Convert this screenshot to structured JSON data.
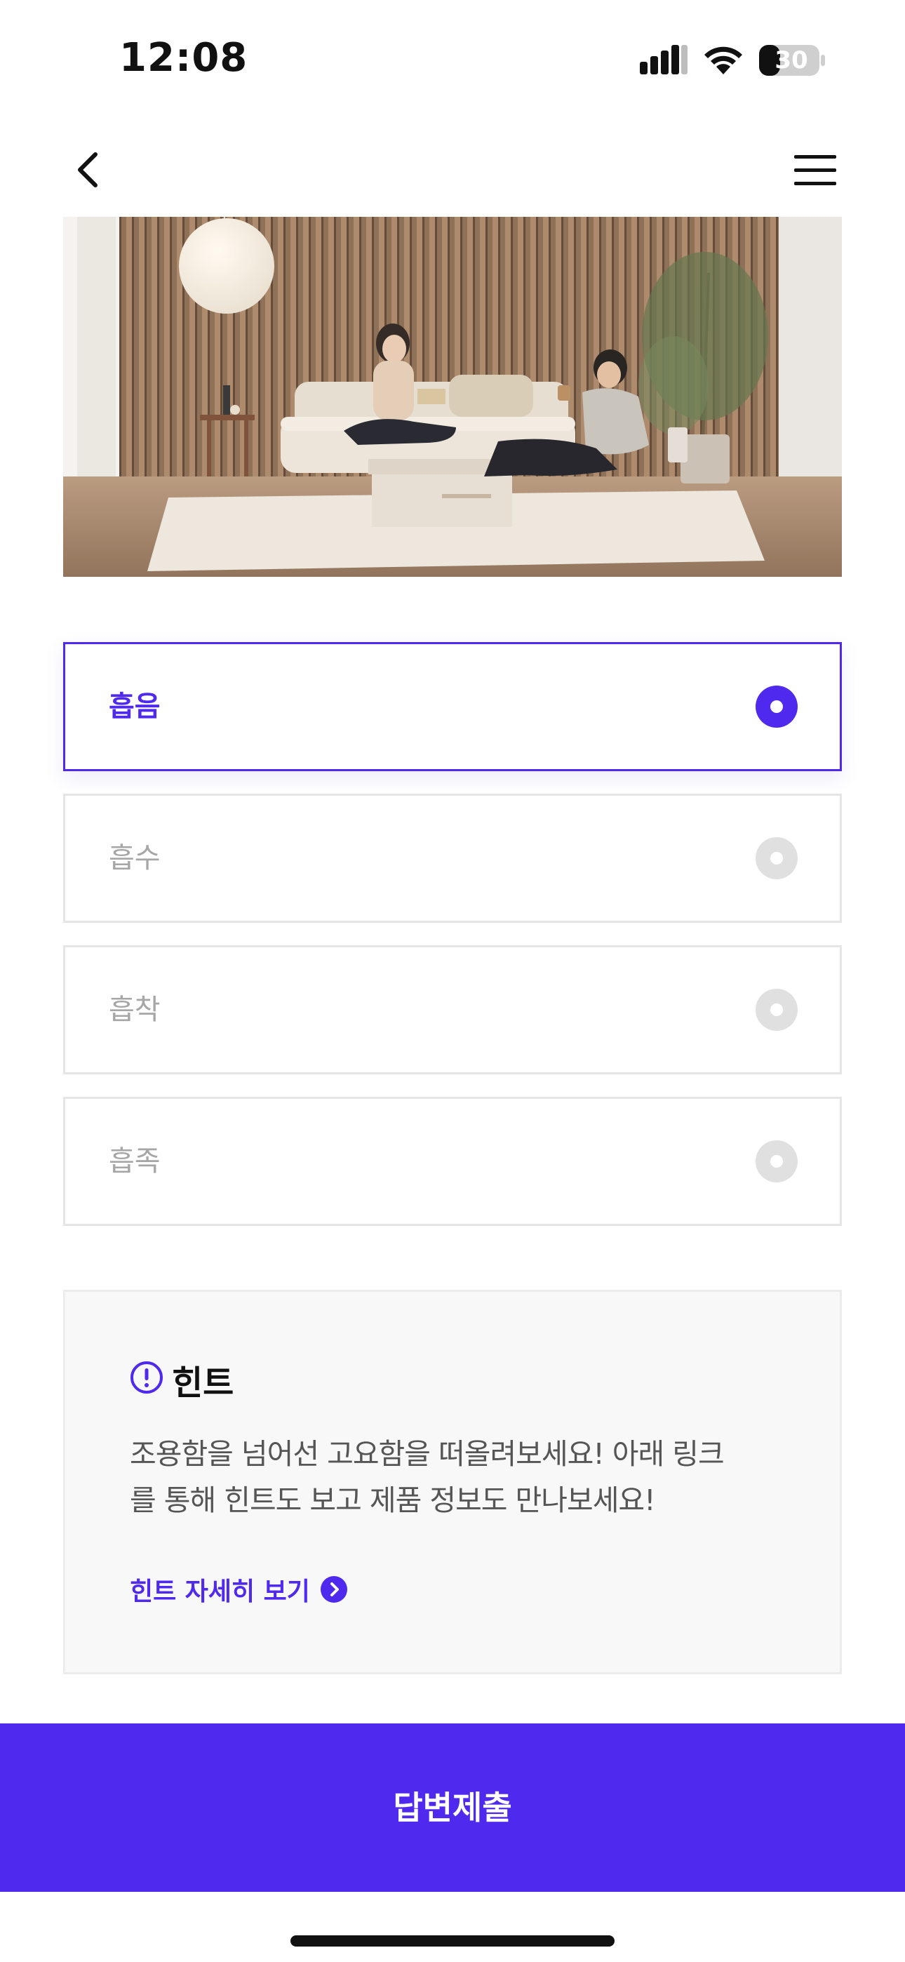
{
  "status_bar": {
    "time": "12:08",
    "battery": "30",
    "icons": [
      "signal-icon",
      "wifi-icon",
      "battery-icon"
    ]
  },
  "nav": {
    "back_icon": "chevron-left-icon",
    "menu_icon": "hamburger-menu-icon"
  },
  "hero": {
    "icon": "living-room-photo"
  },
  "options": [
    {
      "label": "흡음",
      "selected": true
    },
    {
      "label": "흡수",
      "selected": false
    },
    {
      "label": "흡착",
      "selected": false
    },
    {
      "label": "흡족",
      "selected": false
    }
  ],
  "hint": {
    "title": "힌트",
    "body": "조용함을 넘어선 고요함을 떠올려보세요! 아래 링크를 통해 힌트도 보고 제품 정보도 만나보세요!",
    "link_label": "힌트 자세히 보기",
    "icon": "exclamation-circle-icon",
    "link_icon": "chevron-right-circle-icon"
  },
  "submit_label": "답변제출",
  "colors": {
    "accent": "#4f2aee",
    "option_border": "#e5e5e5",
    "option_text": "#a6a6a6",
    "hint_bg": "#f8f8f8"
  }
}
